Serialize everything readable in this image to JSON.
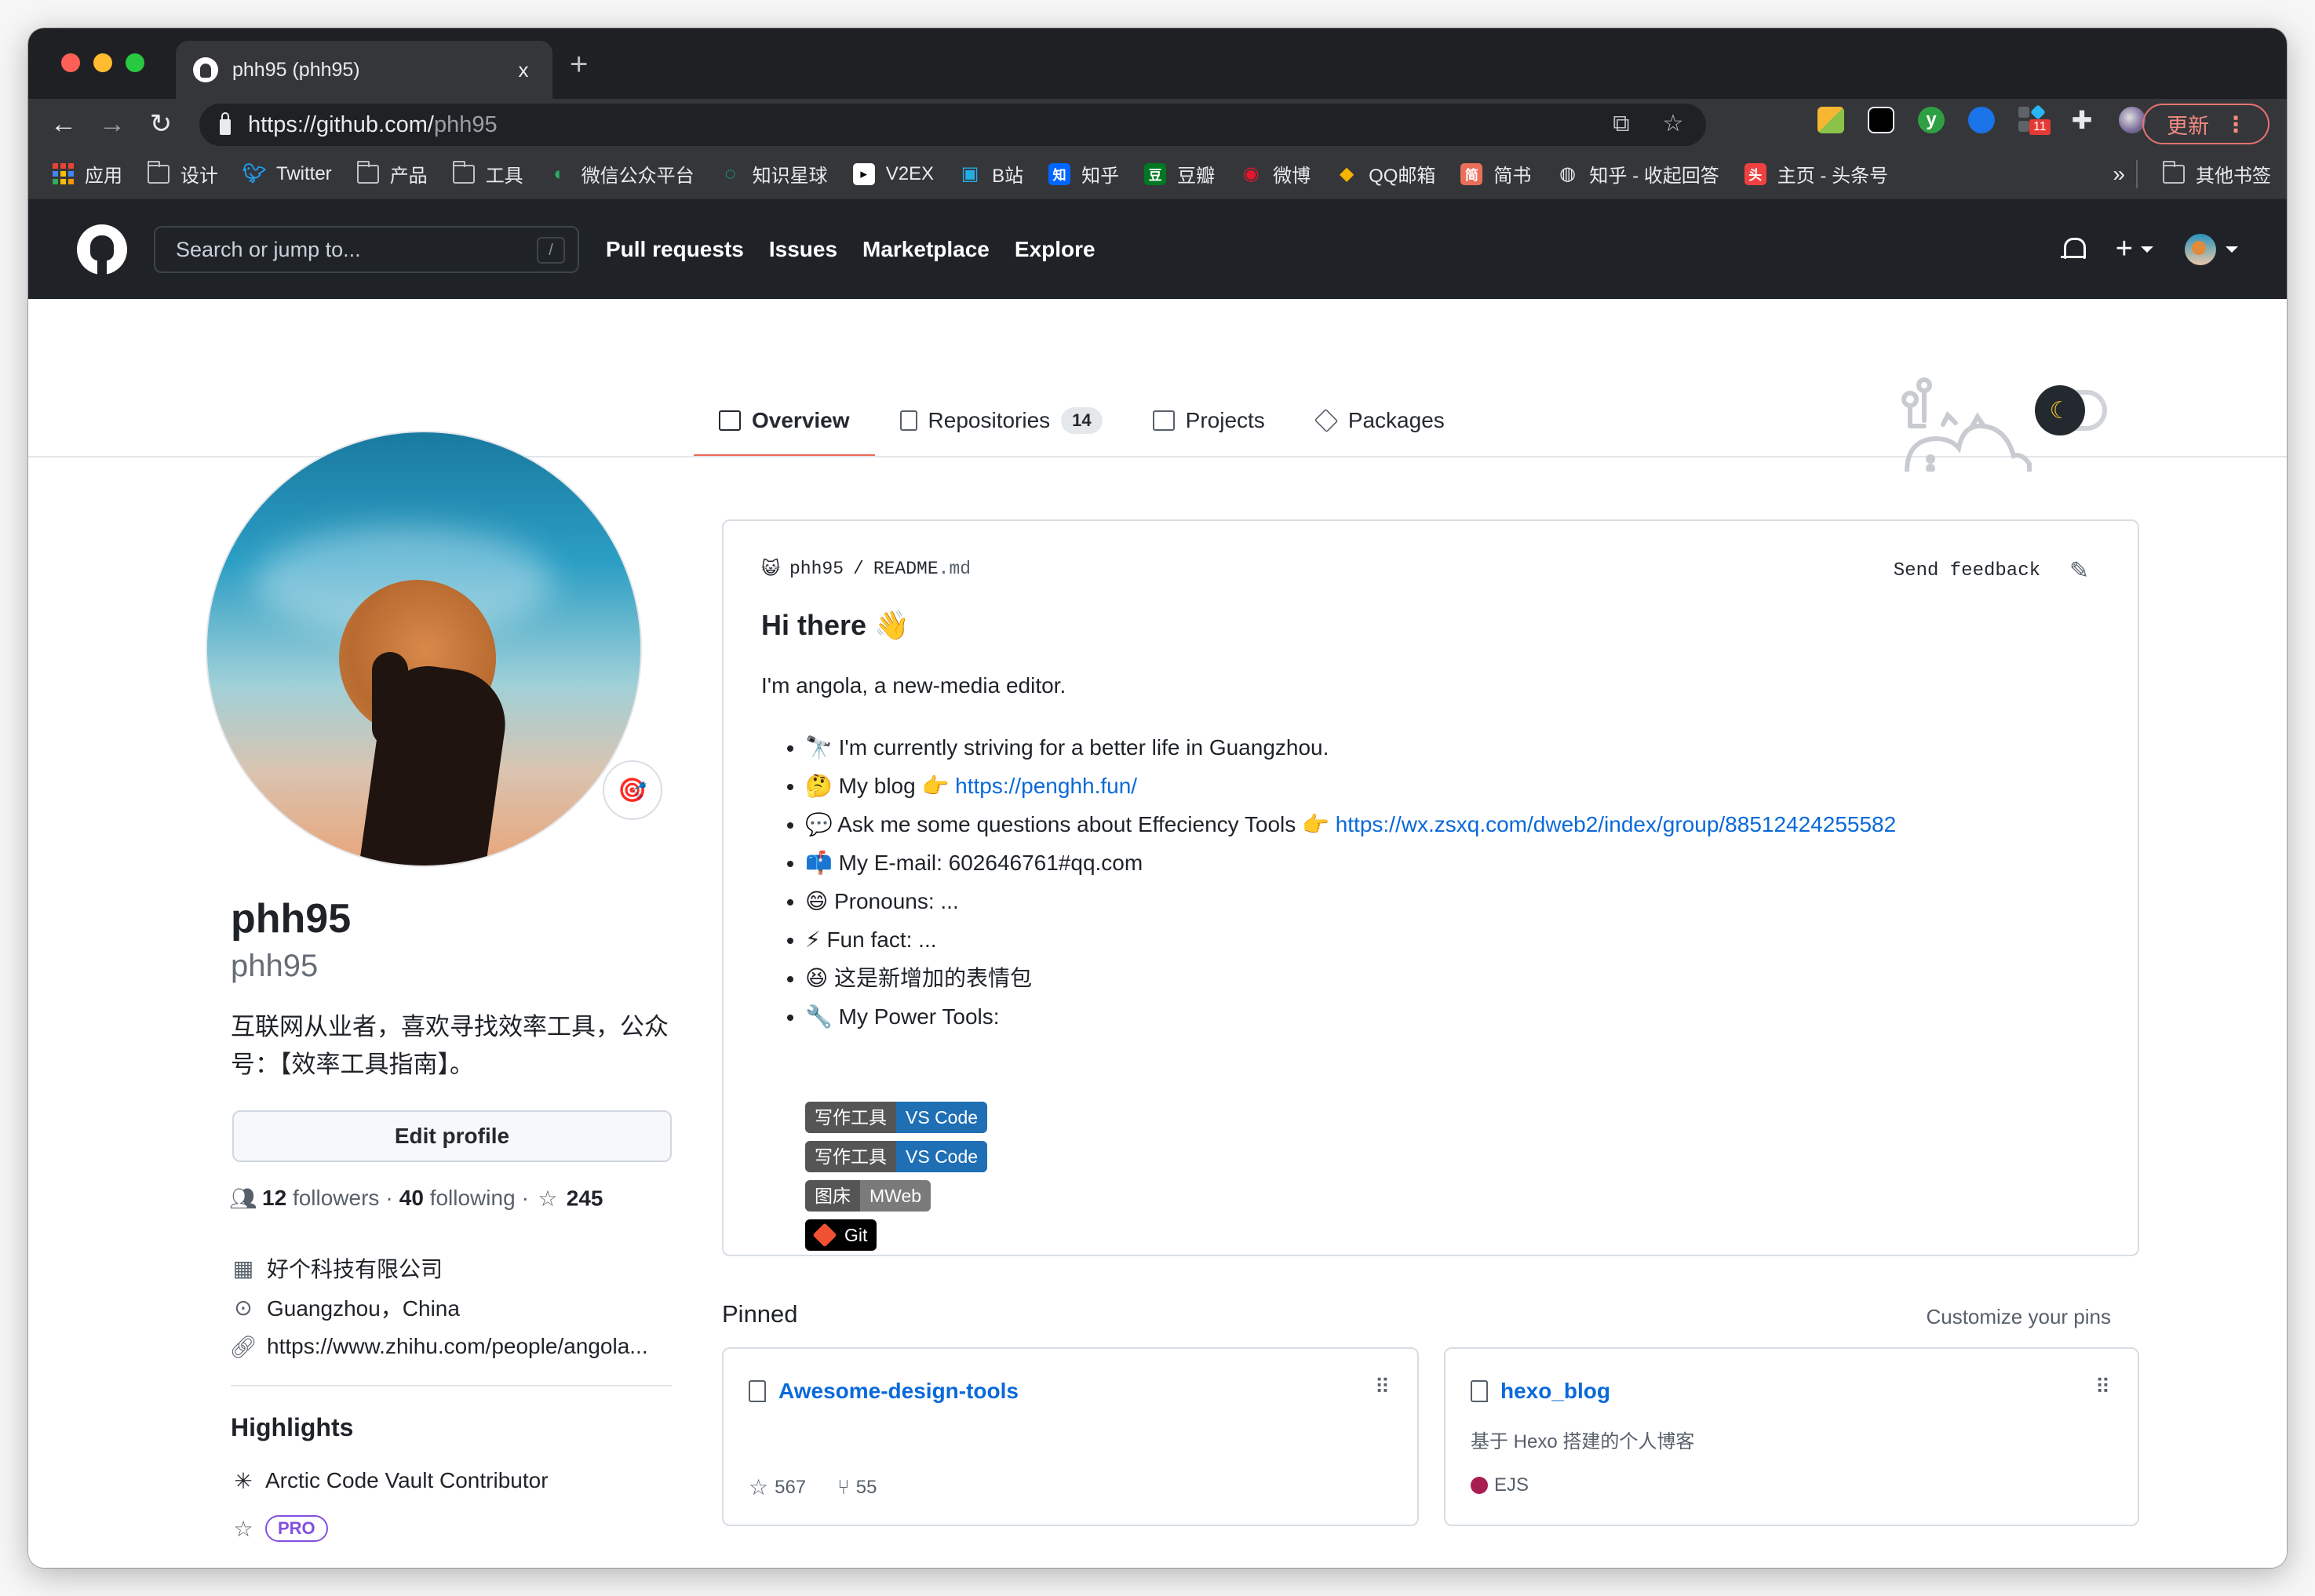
{
  "browser": {
    "tab_title": "phh95 (phh95)",
    "tab_close": "x",
    "new_tab": "+",
    "url_host": "https://github.com/",
    "url_path": "phh95",
    "update_label": "更新",
    "extension_badge": "11",
    "bookmarks": [
      {
        "label": "应用",
        "icon": "apps-grid-icon"
      },
      {
        "label": "设计",
        "icon": "folder-icon"
      },
      {
        "label": "Twitter",
        "icon": "twitter-icon"
      },
      {
        "label": "产品",
        "icon": "folder-icon"
      },
      {
        "label": "工具",
        "icon": "folder-icon"
      },
      {
        "label": "微信公众平台",
        "icon": "wechat-icon"
      },
      {
        "label": "知识星球",
        "icon": "zsxq-icon"
      },
      {
        "label": "V2EX",
        "icon": "v2ex-icon"
      },
      {
        "label": "B站",
        "icon": "bilibili-icon"
      },
      {
        "label": "知乎",
        "icon": "zhihu-icon"
      },
      {
        "label": "豆瓣",
        "icon": "douban-icon"
      },
      {
        "label": "微博",
        "icon": "weibo-icon"
      },
      {
        "label": "QQ邮箱",
        "icon": "qqmail-icon"
      },
      {
        "label": "简书",
        "icon": "jianshu-icon"
      },
      {
        "label": "知乎 - 收起回答",
        "icon": "globe-icon"
      },
      {
        "label": "主页 - 头条号",
        "icon": "toutiao-icon"
      }
    ],
    "bookmarks_more": "»",
    "other_bookmarks": "其他书签"
  },
  "header": {
    "search_placeholder": "Search or jump to...",
    "search_key": "/",
    "nav": [
      "Pull requests",
      "Issues",
      "Marketplace",
      "Explore"
    ]
  },
  "tabs": [
    {
      "label": "Overview",
      "active": true
    },
    {
      "label": "Repositories",
      "count": "14"
    },
    {
      "label": "Projects"
    },
    {
      "label": "Packages"
    }
  ],
  "profile": {
    "name": "phh95",
    "login": "phh95",
    "status_emoji": "🎯",
    "bio": "互联网从业者，喜欢寻找效率工具，公众号：【效率工具指南】。",
    "edit_profile": "Edit profile",
    "followers_count": "12",
    "followers_label": "followers",
    "following_count": "40",
    "following_label": "following",
    "stars_count": "245",
    "company": "好个科技有限公司",
    "location": "Guangzhou，China",
    "website": "https://www.zhihu.com/people/angola...",
    "highlights_title": "Highlights",
    "highlight_vault": "Arctic Code Vault Contributor",
    "pro_label": "PRO"
  },
  "readme": {
    "owner": "phh95",
    "sep": "/",
    "file": "README",
    "ext": ".md",
    "send_feedback": "Send feedback",
    "heading": "Hi there 👋",
    "intro": "I'm angola, a new-media editor.",
    "items": [
      {
        "emoji": "🔭",
        "text": "I'm currently striving for a better life in Guangzhou."
      },
      {
        "emoji": "🤔",
        "text": "My blog 👉 ",
        "link": "https://penghh.fun/"
      },
      {
        "emoji": "💬",
        "text": "Ask me some questions about Effeciency Tools 👉 ",
        "link": "https://wx.zsxq.com/dweb2/index/group/88512424255582"
      },
      {
        "emoji": "📫",
        "text": "My E-mail: 602646761#qq.com"
      },
      {
        "emoji": "😄",
        "text": "Pronouns: ..."
      },
      {
        "emoji": "⚡",
        "text": "Fun fact: ..."
      },
      {
        "emoji": "😆",
        "text": "这是新增加的表情包"
      },
      {
        "emoji": "🔧",
        "text": "My Power Tools:"
      }
    ],
    "badges": [
      {
        "left": "写作工具",
        "right": "VS Code",
        "color": "#1f6fb5"
      },
      {
        "left": "写作工具",
        "right": "VS Code",
        "color": "#1f6fb5"
      },
      {
        "left": "图床",
        "right": "MWeb",
        "color": "#7a7a7a"
      },
      {
        "left": "",
        "right": "Git",
        "color": "#000000"
      }
    ]
  },
  "pinned": {
    "title": "Pinned",
    "customize": "Customize your pins",
    "repos": [
      {
        "name": "Awesome-design-tools",
        "description": "",
        "stars": "567",
        "forks": "55"
      },
      {
        "name": "hexo_blog",
        "description": "基于 Hexo 搭建的个人博客",
        "language": "EJS",
        "language_color": "#a91e50"
      }
    ]
  }
}
